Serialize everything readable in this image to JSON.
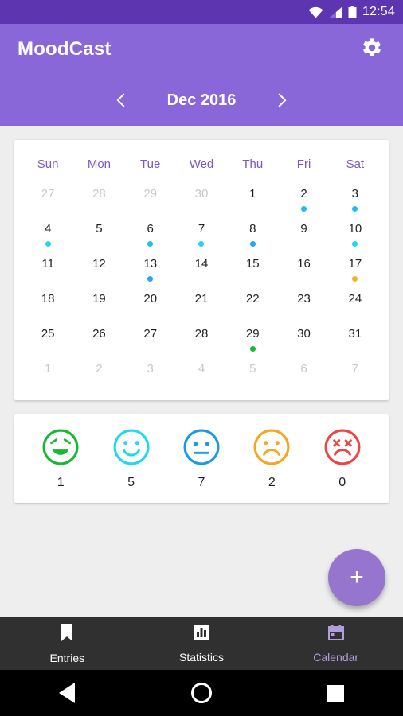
{
  "status_bar": {
    "clock": "12:54",
    "icons": [
      "wifi-icon",
      "signal-icon",
      "battery-icon"
    ]
  },
  "app_bar": {
    "title": "MoodCast",
    "settings_icon": "gear-icon",
    "prev_icon": "chevron-left-icon",
    "next_icon": "chevron-right-icon",
    "month_label": "Dec 2016"
  },
  "calendar": {
    "weekday_headers": [
      "Sun",
      "Mon",
      "Tue",
      "Wed",
      "Thu",
      "Fri",
      "Sat"
    ],
    "weeks": [
      [
        {
          "day": "27",
          "other": true,
          "dot": null
        },
        {
          "day": "28",
          "other": true,
          "dot": null
        },
        {
          "day": "29",
          "other": true,
          "dot": null
        },
        {
          "day": "30",
          "other": true,
          "dot": null
        },
        {
          "day": "1",
          "other": false,
          "dot": null
        },
        {
          "day": "2",
          "other": false,
          "dot": "#22bdf0"
        },
        {
          "day": "3",
          "other": false,
          "dot": "#22bdf0"
        }
      ],
      [
        {
          "day": "4",
          "other": false,
          "dot": "#22d7f0"
        },
        {
          "day": "5",
          "other": false,
          "dot": null
        },
        {
          "day": "6",
          "other": false,
          "dot": "#22bdf0"
        },
        {
          "day": "7",
          "other": false,
          "dot": "#22d7f0"
        },
        {
          "day": "8",
          "other": false,
          "dot": "#22a8f0"
        },
        {
          "day": "9",
          "other": false,
          "dot": null
        },
        {
          "day": "10",
          "other": false,
          "dot": "#22d7f0"
        }
      ],
      [
        {
          "day": "11",
          "other": false,
          "dot": null
        },
        {
          "day": "12",
          "other": false,
          "dot": null
        },
        {
          "day": "13",
          "other": false,
          "dot": "#22a8f0"
        },
        {
          "day": "14",
          "other": false,
          "dot": null
        },
        {
          "day": "15",
          "other": false,
          "dot": null
        },
        {
          "day": "16",
          "other": false,
          "dot": null
        },
        {
          "day": "17",
          "other": false,
          "dot": "#f5b324"
        }
      ],
      [
        {
          "day": "18",
          "other": false,
          "dot": null
        },
        {
          "day": "19",
          "other": false,
          "dot": null
        },
        {
          "day": "20",
          "other": false,
          "dot": null
        },
        {
          "day": "21",
          "other": false,
          "dot": null
        },
        {
          "day": "22",
          "other": false,
          "dot": null
        },
        {
          "day": "23",
          "other": false,
          "dot": null
        },
        {
          "day": "24",
          "other": false,
          "dot": null
        }
      ],
      [
        {
          "day": "25",
          "other": false,
          "dot": null
        },
        {
          "day": "26",
          "other": false,
          "dot": null
        },
        {
          "day": "27",
          "other": false,
          "dot": null
        },
        {
          "day": "28",
          "other": false,
          "dot": null
        },
        {
          "day": "29",
          "other": false,
          "dot": "#19b832"
        },
        {
          "day": "30",
          "other": false,
          "dot": null
        },
        {
          "day": "31",
          "other": false,
          "dot": null
        }
      ],
      [
        {
          "day": "1",
          "other": true,
          "dot": null
        },
        {
          "day": "2",
          "other": true,
          "dot": null
        },
        {
          "day": "3",
          "other": true,
          "dot": null
        },
        {
          "day": "4",
          "other": true,
          "dot": null
        },
        {
          "day": "5",
          "other": true,
          "dot": null
        },
        {
          "day": "6",
          "other": true,
          "dot": null
        },
        {
          "day": "7",
          "other": true,
          "dot": null
        }
      ]
    ]
  },
  "mood_summary": [
    {
      "icon": "mood-great-icon",
      "color": "#19b832",
      "count": "1"
    },
    {
      "icon": "mood-good-icon",
      "color": "#22d7f0",
      "count": "5"
    },
    {
      "icon": "mood-ok-icon",
      "color": "#1b9ae8",
      "count": "7"
    },
    {
      "icon": "mood-bad-icon",
      "color": "#f5a623",
      "count": "2"
    },
    {
      "icon": "mood-awful-icon",
      "color": "#ef4444",
      "count": "0"
    }
  ],
  "fab": {
    "icon": "plus-icon",
    "label": "+"
  },
  "bottom_nav": {
    "items": [
      {
        "label": "Entries",
        "icon": "bookmark-icon",
        "active": false
      },
      {
        "label": "Statistics",
        "icon": "bar-chart-icon",
        "active": false
      },
      {
        "label": "Calendar",
        "icon": "calendar-icon",
        "active": true
      }
    ]
  },
  "system_nav": {
    "back": "back-triangle-icon",
    "home": "home-circle-icon",
    "recents": "recents-square-icon"
  }
}
